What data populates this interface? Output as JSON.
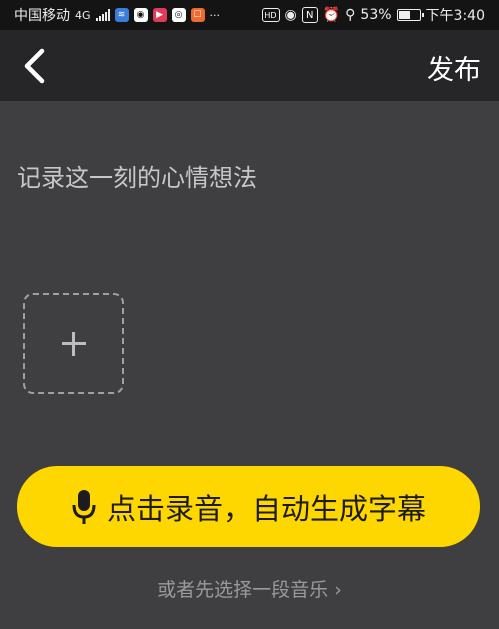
{
  "status_bar": {
    "carrier": "中国移动",
    "network": "4G",
    "battery_percent": "53%",
    "time": "下午3:40",
    "icons": [
      "signal-icon",
      "wifi-icon",
      "qq-icon",
      "video-app-icon",
      "notification-icon",
      "app-icon",
      "more-icon",
      "hd-icon",
      "eye-icon",
      "nfc-icon",
      "alarm-icon",
      "location-icon",
      "battery-icon"
    ]
  },
  "header": {
    "back_icon": "chevron-left-icon",
    "publish_label": "发布"
  },
  "editor": {
    "placeholder": "记录这一刻的心情想法"
  },
  "media": {
    "add_icon": "plus-icon"
  },
  "record_button": {
    "icon": "microphone-icon",
    "label": "点击录音，自动生成字幕",
    "color": "#ffd700"
  },
  "music_link": {
    "label": "或者先选择一段音乐",
    "arrow": "›"
  }
}
